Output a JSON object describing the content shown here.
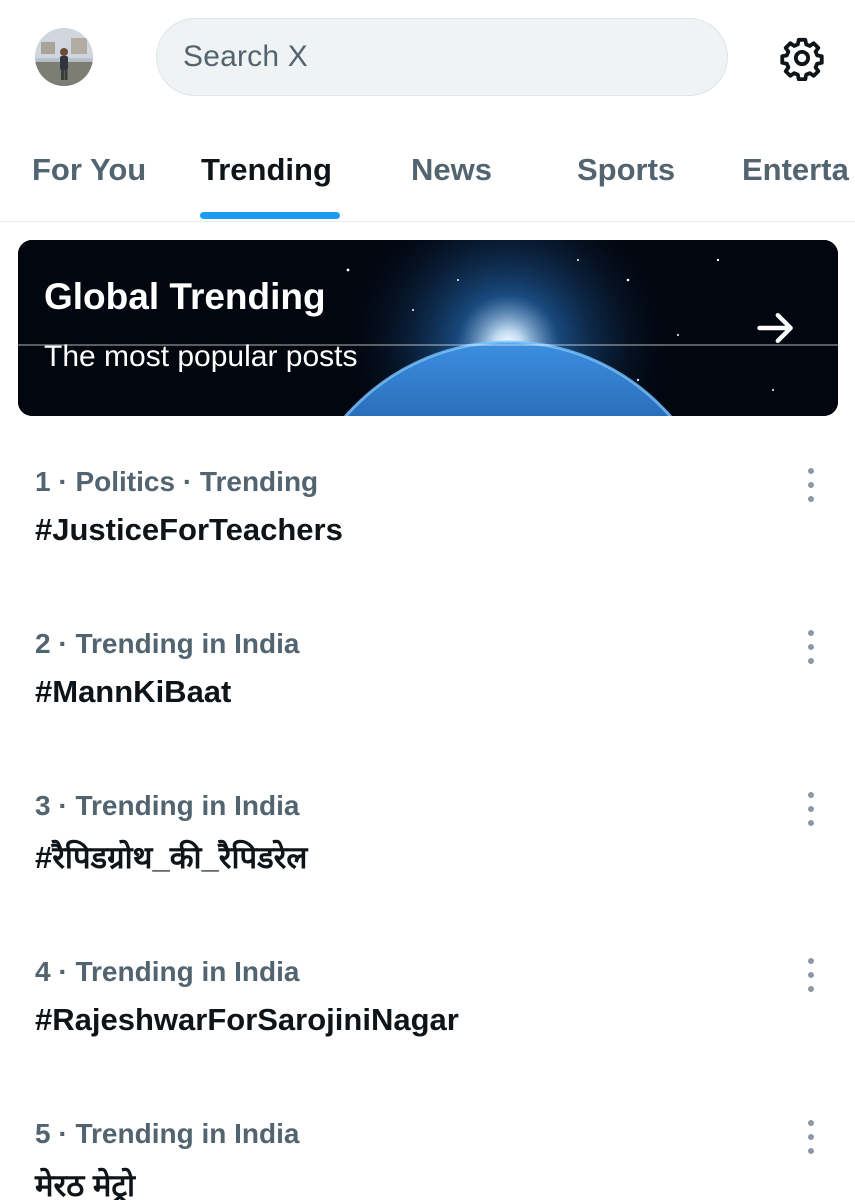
{
  "header": {
    "search_placeholder": "Search X",
    "avatar_icon": "profile-photo",
    "settings_icon": "gear-icon"
  },
  "tabs": [
    {
      "label": "For You",
      "active": false
    },
    {
      "label": "Trending",
      "active": true
    },
    {
      "label": "News",
      "active": false
    },
    {
      "label": "Sports",
      "active": false
    },
    {
      "label": "Enterta",
      "active": false
    }
  ],
  "banner": {
    "title": "Global Trending",
    "subtitle": "The most popular posts",
    "arrow_icon": "arrow-right-icon"
  },
  "trends": [
    {
      "meta": "1 · Politics · Trending",
      "name": "#JusticeForTeachers"
    },
    {
      "meta": "2 · Trending in India",
      "name": "#MannKiBaat"
    },
    {
      "meta": "3 · Trending in India",
      "name": "#रैपिडग्रोथ_की_रैपिडरेल"
    },
    {
      "meta": "4 · Trending in India",
      "name": "#RajeshwarForSarojiniNagar"
    },
    {
      "meta": "5 · Trending in India",
      "name": "मेरठ मेट्रो"
    }
  ],
  "colors": {
    "accent": "#1d9bf0",
    "secondary_text": "#536471",
    "primary_text": "#0f1419"
  }
}
